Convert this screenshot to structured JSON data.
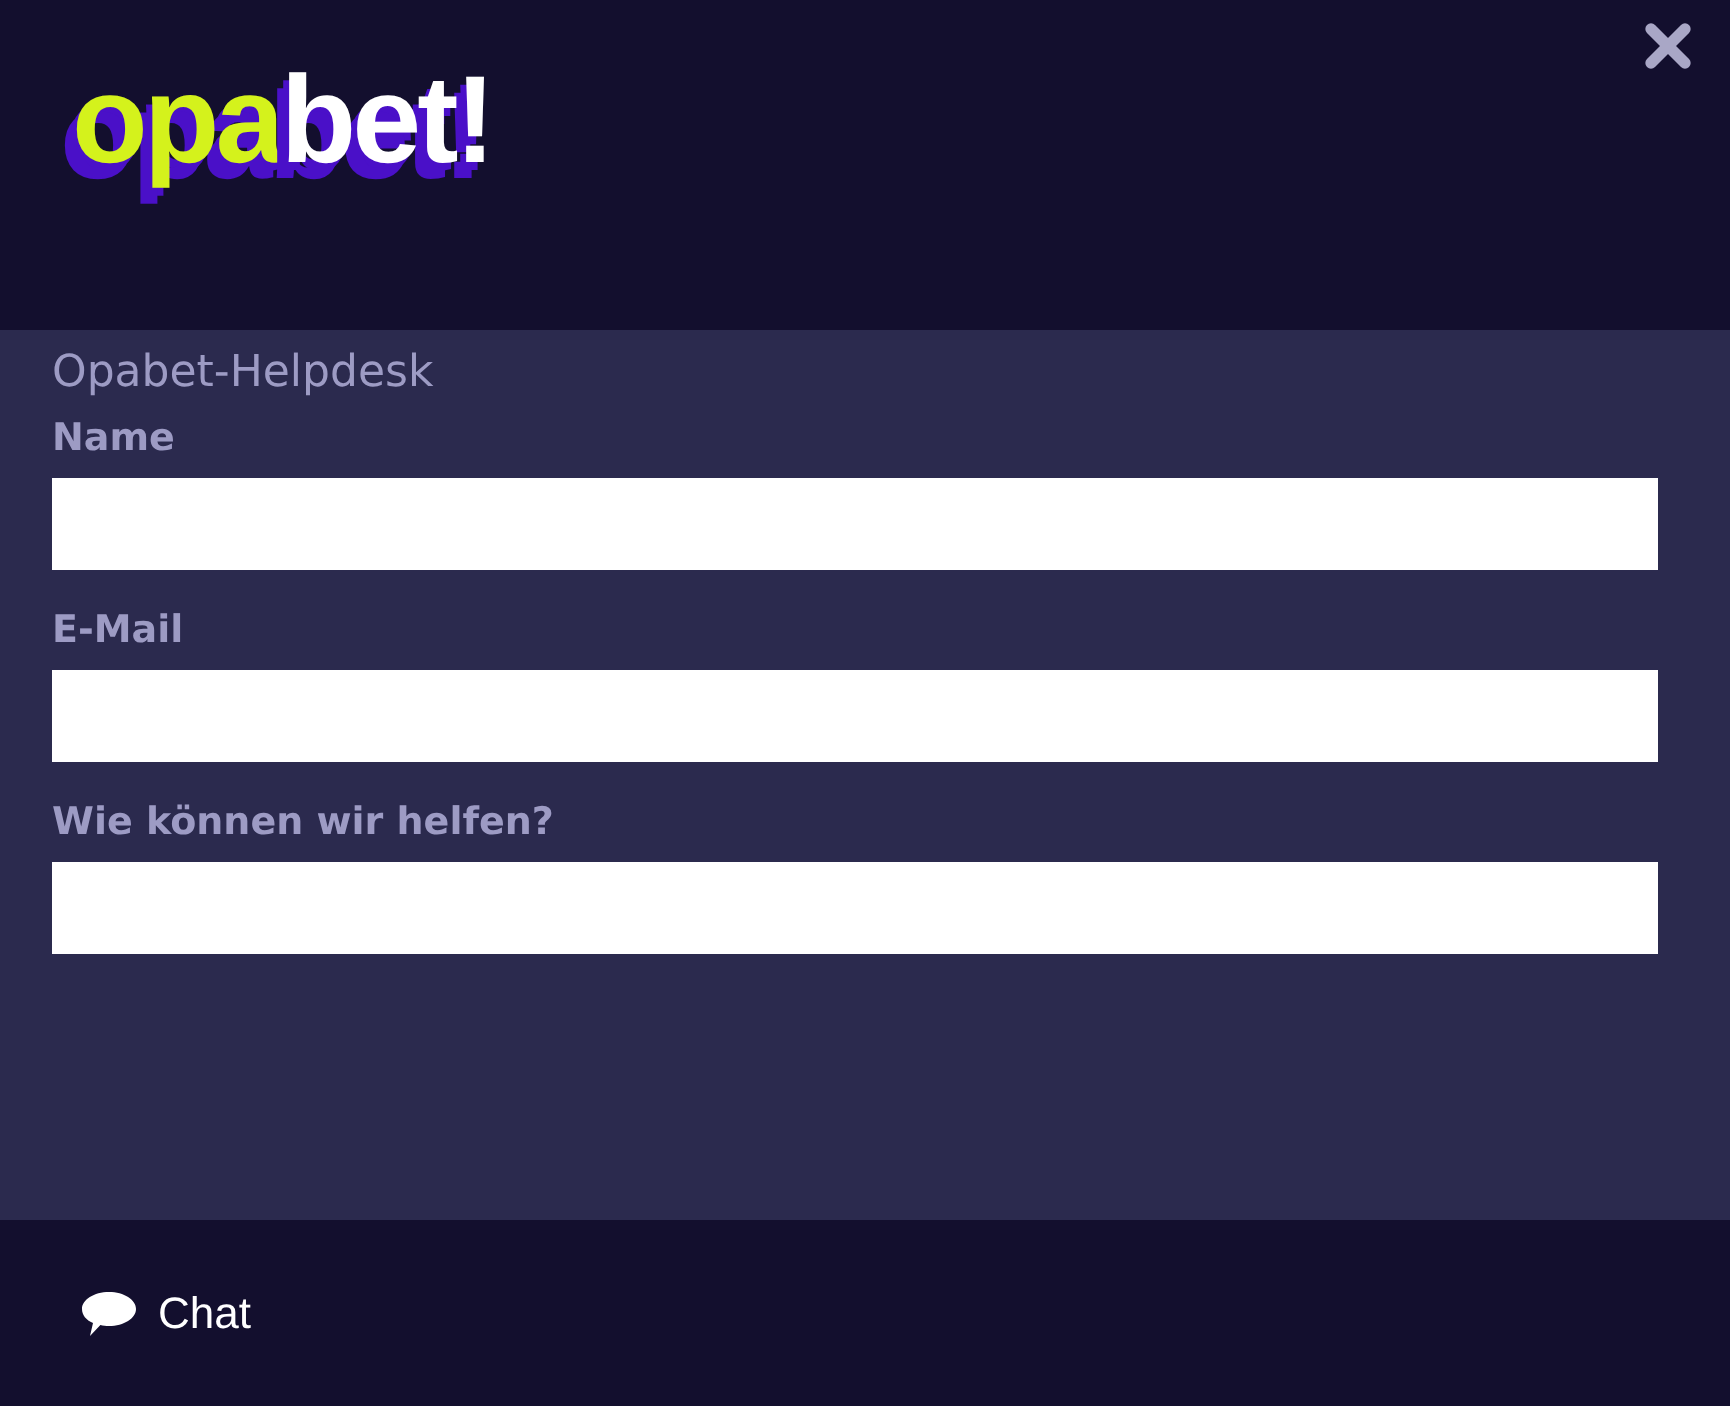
{
  "logo": {
    "parts": [
      {
        "text": "opa",
        "color": "#d4f21c"
      },
      {
        "text": "bet!",
        "color": "#ffffff"
      }
    ]
  },
  "form": {
    "title": "Opabet-Helpdesk",
    "fields": [
      {
        "label": "Name"
      },
      {
        "label": "E-Mail"
      },
      {
        "label": "Wie können wir helfen?"
      }
    ]
  },
  "footer": {
    "chat": "Chat"
  }
}
